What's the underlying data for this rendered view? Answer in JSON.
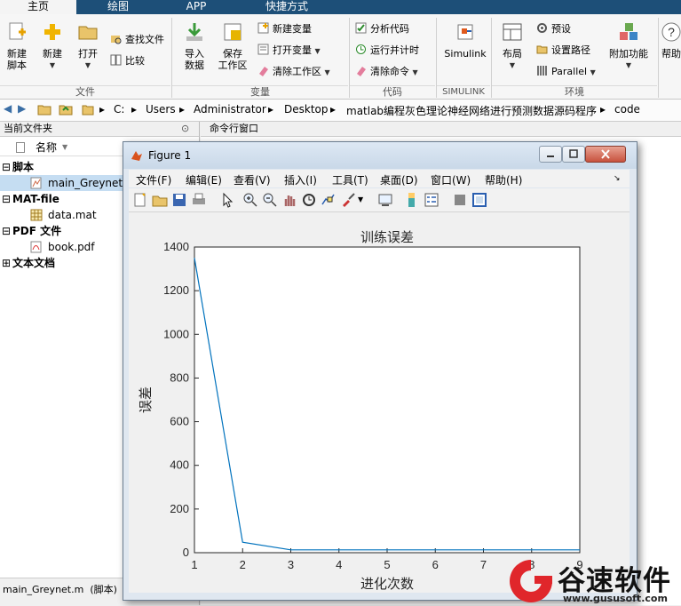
{
  "tabs": [
    "主页",
    "绘图",
    "APP",
    "快捷方式"
  ],
  "ribbon": {
    "file": {
      "new_script": "新建\n脚本",
      "new": "新建",
      "open": "打开",
      "find_files": "查找文件",
      "compare": "比较",
      "section": "文件"
    },
    "variable": {
      "import": "导入\n数据",
      "save_ws": "保存\n工作区",
      "new_var": "新建变量",
      "open_var": "打开变量",
      "clear_ws": "清除工作区",
      "section": "变量"
    },
    "code": {
      "analyze": "分析代码",
      "run_time": "运行并计时",
      "clear_cmd": "清除命令",
      "section": "代码"
    },
    "simulink": {
      "label": "Simulink",
      "section": "SIMULINK"
    },
    "env": {
      "layout": "布局",
      "prefs": "预设",
      "set_path": "设置路径",
      "parallel": "Parallel",
      "addons": "附加功能",
      "section": "环境"
    },
    "help": "帮助"
  },
  "address": [
    "C:",
    "Users",
    "Administrator",
    "Desktop",
    "matlab编程灰色理论神经网络进行预测数据源码程序",
    "code"
  ],
  "left_panel": {
    "title": "当前文件夹",
    "col_name": "名称",
    "groups": [
      {
        "label": "脚本",
        "items": [
          "main_Greynet.m"
        ]
      },
      {
        "label": "MAT-file",
        "items": [
          "data.mat"
        ]
      },
      {
        "label": "PDF 文件",
        "items": [
          "book.pdf"
        ]
      },
      {
        "label": "文本文档",
        "items": []
      }
    ],
    "status": "main_Greynet.m  (脚本)"
  },
  "cmd_panel": {
    "title": "命令行窗口"
  },
  "figure": {
    "title": "Figure 1",
    "menu": [
      "文件(F)",
      "编辑(E)",
      "查看(V)",
      "插入(I)",
      "工具(T)",
      "桌面(D)",
      "窗口(W)",
      "帮助(H)"
    ]
  },
  "chart_data": {
    "type": "line",
    "title": "训练误差",
    "xlabel": "进化次数",
    "ylabel": "误差",
    "xlim": [
      1,
      9
    ],
    "ylim": [
      0,
      1400
    ],
    "xticks": [
      1,
      2,
      3,
      4,
      5,
      6,
      7,
      8,
      9
    ],
    "yticks": [
      0,
      200,
      400,
      600,
      800,
      1000,
      1200,
      1400
    ],
    "color": "#0072bd",
    "x": [
      1,
      2,
      3,
      4,
      5,
      6,
      7,
      8,
      9
    ],
    "y": [
      1350,
      48,
      13,
      13,
      13,
      13,
      13,
      13,
      13
    ]
  },
  "watermark": {
    "brand": "谷速软件",
    "url": "www.gususoft.com"
  }
}
